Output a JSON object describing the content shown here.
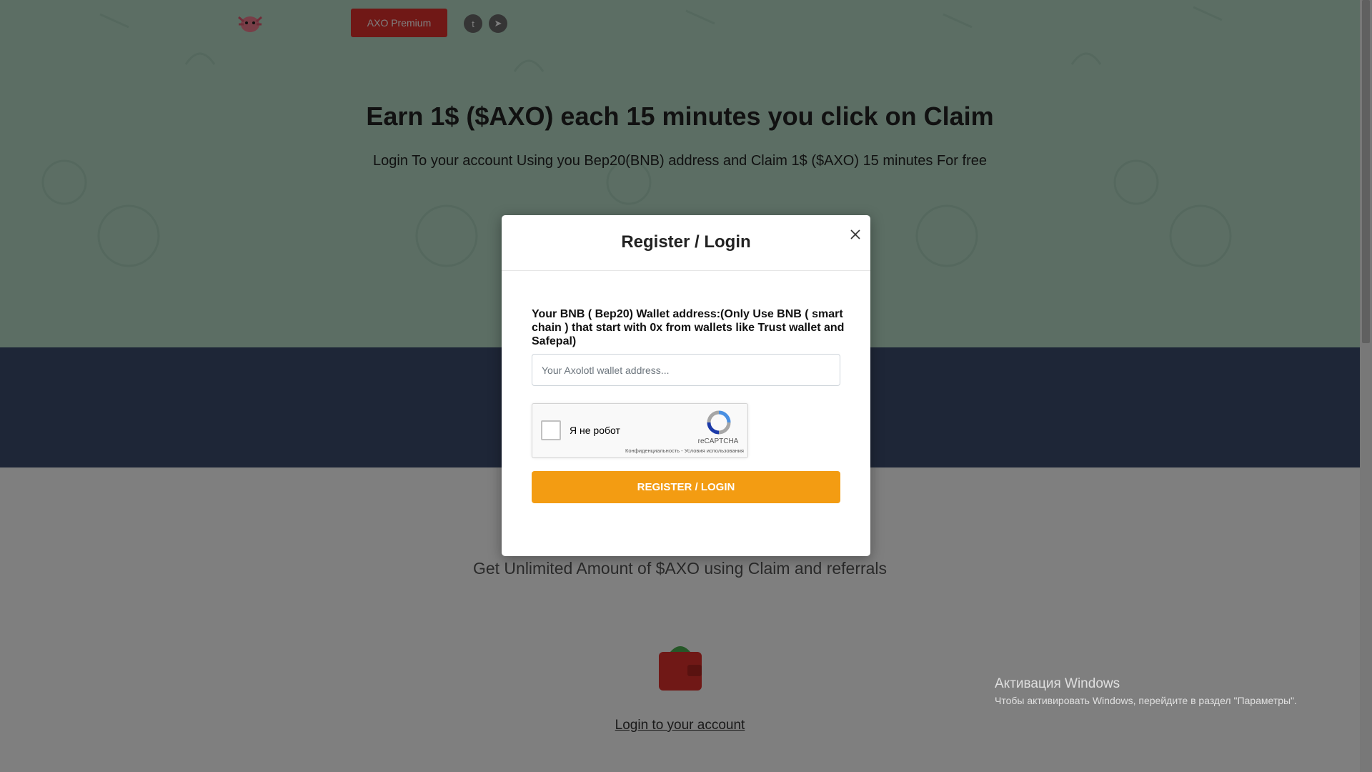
{
  "topbar": {
    "premium_label": "AXO Premium",
    "social": [
      {
        "icon": "twitter-icon",
        "glyph": "t"
      },
      {
        "icon": "telegram-icon",
        "glyph": "➤"
      }
    ]
  },
  "hero": {
    "title": "Earn 1$ ($AXO) each 15 minutes you click on Claim",
    "subtitle": "Login To your account Using you Bep20(BNB) address and Claim 1$ ($AXO) 15 minutes For free"
  },
  "section": {
    "unlimited_text": "Get Unlimited Amount of $AXO using Claim and referrals",
    "login_link": "Login to your account"
  },
  "modal": {
    "title": "Register / Login",
    "field_label": "Your BNB ( Bep20) Wallet address:(Only Use BNB ( smart chain ) that start with 0x from wallets like Trust wallet and Safepal)",
    "input": {
      "value": "",
      "placeholder": "Your Axolotl wallet address..."
    },
    "recaptcha": {
      "label": "Я не робот",
      "brand": "reCAPTCHA",
      "privacy": "Конфиденциальность",
      "separator": " - ",
      "terms": "Условия использования"
    },
    "submit_label": "REGISTER / LOGIN"
  },
  "windows_watermark": {
    "title": "Активация Windows",
    "subtitle": "Чтобы активировать Windows, перейдите в раздел \"Параметры\"."
  },
  "colors": {
    "hero_bg": "#b8ddc9",
    "dark_band": "#3c4d6e",
    "premium": "#e0302c",
    "submit": "#f39c12"
  }
}
